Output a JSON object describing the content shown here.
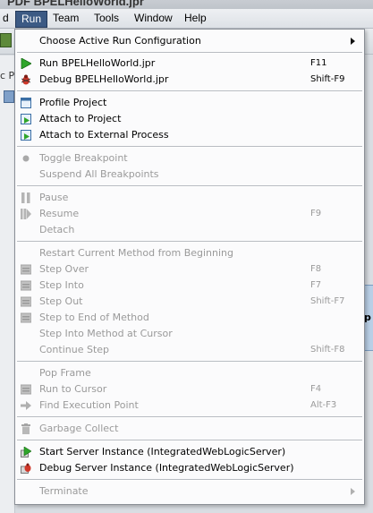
{
  "app": {
    "title_fragment": "PDF BPELHelloWorld.jpr",
    "left_tab_fragment": "c Pe"
  },
  "menubar": [
    {
      "label": "d"
    },
    {
      "label": "Run"
    },
    {
      "label": "Team"
    },
    {
      "label": "Tools"
    },
    {
      "label": "Window"
    },
    {
      "label": "Help"
    }
  ],
  "editor": {
    "fragment": "p"
  },
  "run_menu": {
    "choose_config": {
      "label": "Choose Active Run Configuration"
    },
    "run_project": {
      "label": "Run BPELHelloWorld.jpr",
      "shortcut": "F11"
    },
    "debug_project": {
      "label": "Debug BPELHelloWorld.jpr",
      "shortcut": "Shift-F9"
    },
    "profile_project": {
      "label": "Profile Project"
    },
    "attach_project": {
      "label": "Attach to Project"
    },
    "attach_external": {
      "label": "Attach to External Process"
    },
    "toggle_breakpoint": {
      "label": "Toggle Breakpoint"
    },
    "suspend_breakpoints": {
      "label": "Suspend All Breakpoints"
    },
    "pause": {
      "label": "Pause"
    },
    "resume": {
      "label": "Resume",
      "shortcut": "F9"
    },
    "detach": {
      "label": "Detach"
    },
    "restart_method": {
      "label": "Restart Current Method from Beginning"
    },
    "step_over": {
      "label": "Step Over",
      "shortcut": "F8"
    },
    "step_into": {
      "label": "Step Into",
      "shortcut": "F7"
    },
    "step_out": {
      "label": "Step Out",
      "shortcut": "Shift-F7"
    },
    "step_end_method": {
      "label": "Step to End of Method"
    },
    "step_into_cursor": {
      "label": "Step Into Method at Cursor"
    },
    "continue_step": {
      "label": "Continue Step",
      "shortcut": "Shift-F8"
    },
    "pop_frame": {
      "label": "Pop Frame"
    },
    "run_to_cursor": {
      "label": "Run to Cursor",
      "shortcut": "F4"
    },
    "find_exec_point": {
      "label": "Find Execution Point",
      "shortcut": "Alt-F3"
    },
    "garbage_collect": {
      "label": "Garbage Collect"
    },
    "start_server": {
      "label": "Start Server Instance (IntegratedWebLogicServer)"
    },
    "debug_server": {
      "label": "Debug Server Instance (IntegratedWebLogicServer)"
    },
    "terminate": {
      "label": "Terminate"
    }
  },
  "colors": {
    "menubar_active": "#3c5a84",
    "disabled_text": "#9a9a9a",
    "run_green": "#2fa52a",
    "debug_red": "#d0382b"
  }
}
